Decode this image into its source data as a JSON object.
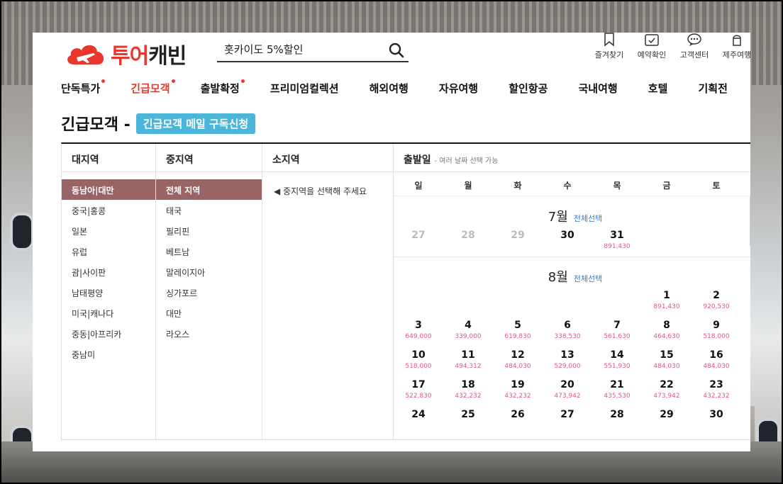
{
  "header": {
    "logo_red": "투어",
    "logo_dark": "캐빈",
    "search_value": "홋카이도 5%할인",
    "util": [
      "즐겨찾기",
      "예약확인",
      "고객센터",
      "제주여행"
    ]
  },
  "nav": [
    {
      "label": "단독특가",
      "dot": true,
      "active": false
    },
    {
      "label": "긴급모객",
      "dot": true,
      "active": true
    },
    {
      "label": "출발확정",
      "dot": true,
      "active": false
    },
    {
      "label": "프리미엄컬렉션",
      "dot": false,
      "active": false
    },
    {
      "label": "해외여행",
      "dot": false,
      "active": false
    },
    {
      "label": "자유여행",
      "dot": false,
      "active": false
    },
    {
      "label": "할인항공",
      "dot": false,
      "active": false
    },
    {
      "label": "국내여행",
      "dot": false,
      "active": false
    },
    {
      "label": "호텔",
      "dot": false,
      "active": false
    },
    {
      "label": "기획전",
      "dot": false,
      "active": false
    }
  ],
  "page": {
    "title": "긴급모객 -",
    "subscribe_button": "긴급모객 메일 구독신청"
  },
  "columns": {
    "region": {
      "header": "대지역",
      "items": [
        "동남아|대만",
        "중국|홍콩",
        "일본",
        "유럽",
        "괌|사이판",
        "남태평양",
        "미국|캐나다",
        "중동|아프리카",
        "중남미"
      ],
      "selected": 0
    },
    "mid": {
      "header": "중지역",
      "items": [
        "전체 지역",
        "태국",
        "필리핀",
        "베트남",
        "말레이지아",
        "싱가포르",
        "대만",
        "라오스"
      ],
      "selected": 0
    },
    "sub": {
      "header": "소지역",
      "note": "◀ 중지역을 선택해 주세요"
    },
    "depart": {
      "header": "출발일",
      "hint": "- 여러 날짜 선택 가능"
    }
  },
  "calendar": {
    "weekdays": [
      "일",
      "월",
      "화",
      "수",
      "목",
      "금",
      "토"
    ],
    "select_all_label": "전체선택",
    "months": [
      {
        "name": "7월",
        "weeks": [
          [
            {
              "d": "27",
              "past": true
            },
            {
              "d": "28",
              "past": true
            },
            {
              "d": "29",
              "past": true
            },
            {
              "d": "30"
            },
            {
              "d": "31",
              "p": "891,430"
            },
            null,
            null
          ]
        ]
      },
      {
        "name": "8월",
        "weeks": [
          [
            null,
            null,
            null,
            null,
            null,
            {
              "d": "1",
              "p": "891,430"
            },
            {
              "d": "2",
              "p": "920,530"
            }
          ],
          [
            {
              "d": "3",
              "p": "649,000"
            },
            {
              "d": "4",
              "p": "339,000"
            },
            {
              "d": "5",
              "p": "619,830"
            },
            {
              "d": "6",
              "p": "338,530"
            },
            {
              "d": "7",
              "p": "561,630"
            },
            {
              "d": "8",
              "p": "464,630"
            },
            {
              "d": "9",
              "p": "518,000"
            }
          ],
          [
            {
              "d": "10",
              "p": "518,000"
            },
            {
              "d": "11",
              "p": "494,312"
            },
            {
              "d": "12",
              "p": "484,030"
            },
            {
              "d": "13",
              "p": "529,000"
            },
            {
              "d": "14",
              "p": "551,930"
            },
            {
              "d": "15",
              "p": "484,030"
            },
            {
              "d": "16",
              "p": "484,030"
            }
          ],
          [
            {
              "d": "17",
              "p": "522,830"
            },
            {
              "d": "18",
              "p": "432,232"
            },
            {
              "d": "19",
              "p": "432,232"
            },
            {
              "d": "20",
              "p": "473,942"
            },
            {
              "d": "21",
              "p": "435,530"
            },
            {
              "d": "22",
              "p": "473,942"
            },
            {
              "d": "23",
              "p": "432,232"
            }
          ],
          [
            {
              "d": "24"
            },
            {
              "d": "25"
            },
            {
              "d": "26"
            },
            {
              "d": "27"
            },
            {
              "d": "28"
            },
            {
              "d": "29"
            },
            {
              "d": "30"
            }
          ]
        ]
      }
    ]
  },
  "colors": {
    "brand_red": "#e8382e",
    "subscribe_blue": "#4bb6d9",
    "selected_bg": "#9b6464",
    "price_pink": "#e8557a",
    "link_blue": "#2d7bd1"
  }
}
